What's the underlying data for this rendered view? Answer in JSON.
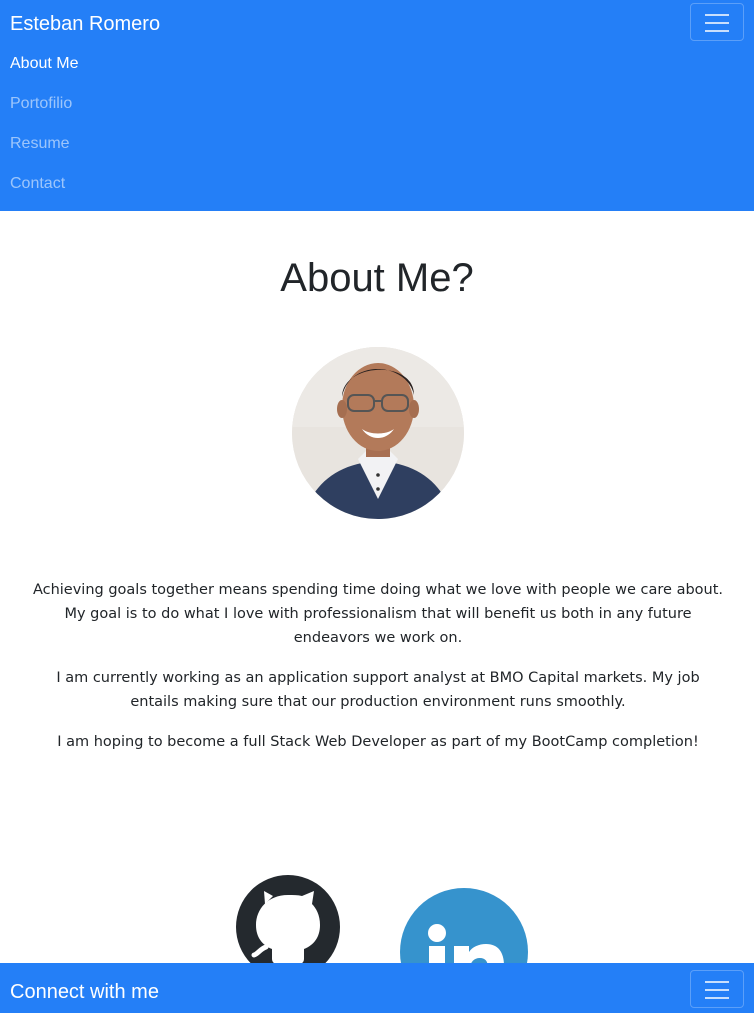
{
  "navbar": {
    "brand": "Esteban Romero",
    "toggler_icon": "hamburger-icon",
    "items": [
      {
        "label": "About Me",
        "active": true
      },
      {
        "label": "Portofilio",
        "active": false
      },
      {
        "label": "Resume",
        "active": false
      },
      {
        "label": "Contact",
        "active": false
      }
    ]
  },
  "main": {
    "title": "About Me?",
    "paragraphs": [
      "Achieving goals together means spending time doing what we love with people we care about. My goal is to do what I love with professionalism that will benefit us both in any future endeavors we work on.",
      "I am currently working as an application support analyst at BMO Capital markets. My job entails making sure that our production environment runs smoothly.",
      "I am hoping to become a full Stack Web Developer as part of my BootCamp completion!"
    ],
    "social": [
      {
        "icon": "github-icon"
      },
      {
        "icon": "linkedin-icon"
      }
    ]
  },
  "footer": {
    "label": "Connect with me",
    "toggler_icon": "hamburger-icon"
  },
  "colors": {
    "primary": "#247ff7",
    "github": "#24292e",
    "linkedin": "#3693cd"
  }
}
